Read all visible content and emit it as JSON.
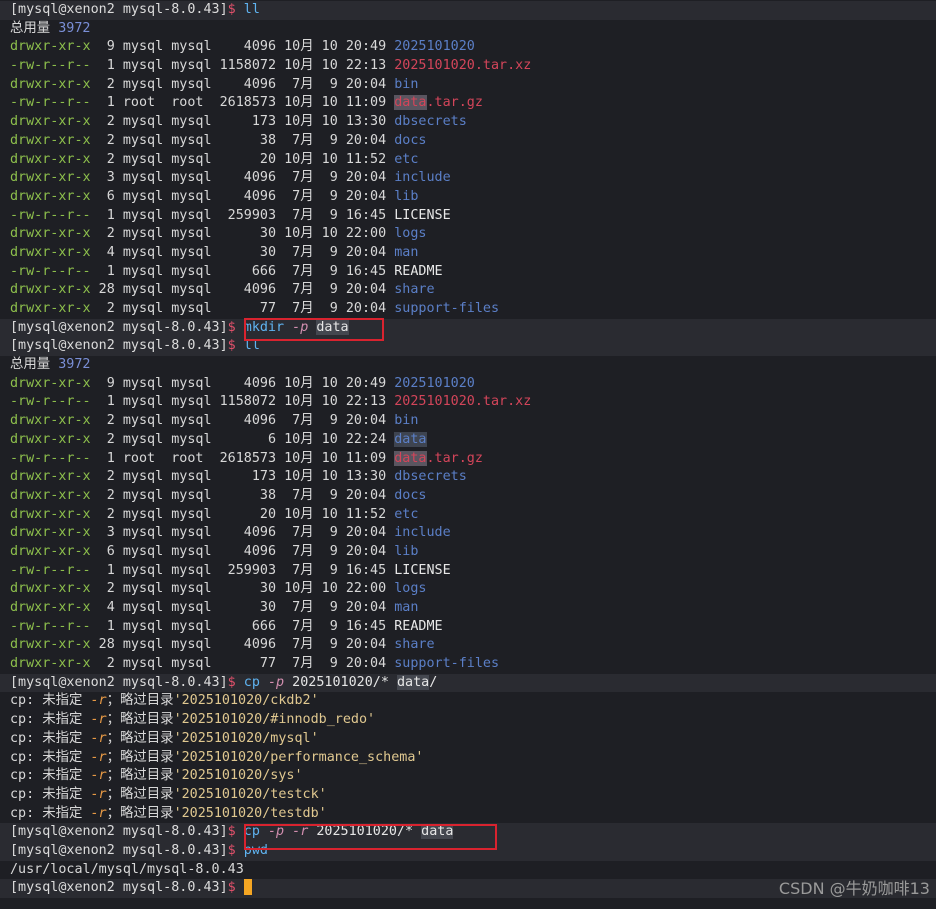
{
  "prompt": {
    "user": "mysql",
    "host": "xenon2",
    "dir": "mysql-8.0.43"
  },
  "listing1": {
    "total_label": "总用量",
    "total_value": "3972",
    "rows": [
      {
        "perm": "drwxr-xr-x",
        "links": " 9",
        "owner": "mysql",
        "group": "mysql",
        "size": "   4096",
        "month": "10月",
        "day": "10",
        "time": "20:49",
        "name": "2025101020",
        "type": "dir"
      },
      {
        "perm": "-rw-r--r--",
        "links": " 1",
        "owner": "mysql",
        "group": "mysql",
        "size": "1158072",
        "month": "10月",
        "day": "10",
        "time": "22:13",
        "name": "2025101020.tar.xz",
        "type": "arch"
      },
      {
        "perm": "drwxr-xr-x",
        "links": " 2",
        "owner": "mysql",
        "group": "mysql",
        "size": "   4096",
        "month": " 7月",
        "day": " 9",
        "time": "20:04",
        "name": "bin",
        "type": "dir"
      },
      {
        "perm": "-rw-r--r--",
        "links": " 1",
        "owner": "root ",
        "group": "root ",
        "size": "2618573",
        "month": "10月",
        "day": "10",
        "time": "11:09",
        "name_hl": "data",
        "name_rest": ".tar.gz",
        "type": "arch-hl"
      },
      {
        "perm": "drwxr-xr-x",
        "links": " 2",
        "owner": "mysql",
        "group": "mysql",
        "size": "    173",
        "month": "10月",
        "day": "10",
        "time": "13:30",
        "name": "dbsecrets",
        "type": "dir"
      },
      {
        "perm": "drwxr-xr-x",
        "links": " 2",
        "owner": "mysql",
        "group": "mysql",
        "size": "     38",
        "month": " 7月",
        "day": " 9",
        "time": "20:04",
        "name": "docs",
        "type": "dir"
      },
      {
        "perm": "drwxr-xr-x",
        "links": " 2",
        "owner": "mysql",
        "group": "mysql",
        "size": "     20",
        "month": "10月",
        "day": "10",
        "time": "11:52",
        "name": "etc",
        "type": "dir"
      },
      {
        "perm": "drwxr-xr-x",
        "links": " 3",
        "owner": "mysql",
        "group": "mysql",
        "size": "   4096",
        "month": " 7月",
        "day": " 9",
        "time": "20:04",
        "name": "include",
        "type": "dir"
      },
      {
        "perm": "drwxr-xr-x",
        "links": " 6",
        "owner": "mysql",
        "group": "mysql",
        "size": "   4096",
        "month": " 7月",
        "day": " 9",
        "time": "20:04",
        "name": "lib",
        "type": "dir"
      },
      {
        "perm": "-rw-r--r--",
        "links": " 1",
        "owner": "mysql",
        "group": "mysql",
        "size": " 259903",
        "month": " 7月",
        "day": " 9",
        "time": "16:45",
        "name": "LICENSE",
        "type": "plain"
      },
      {
        "perm": "drwxr-xr-x",
        "links": " 2",
        "owner": "mysql",
        "group": "mysql",
        "size": "     30",
        "month": "10月",
        "day": "10",
        "time": "22:00",
        "name": "logs",
        "type": "dir"
      },
      {
        "perm": "drwxr-xr-x",
        "links": " 4",
        "owner": "mysql",
        "group": "mysql",
        "size": "     30",
        "month": " 7月",
        "day": " 9",
        "time": "20:04",
        "name": "man",
        "type": "dir"
      },
      {
        "perm": "-rw-r--r--",
        "links": " 1",
        "owner": "mysql",
        "group": "mysql",
        "size": "    666",
        "month": " 7月",
        "day": " 9",
        "time": "16:45",
        "name": "README",
        "type": "plain"
      },
      {
        "perm": "drwxr-xr-x",
        "links": "28",
        "owner": "mysql",
        "group": "mysql",
        "size": "   4096",
        "month": " 7月",
        "day": " 9",
        "time": "20:04",
        "name": "share",
        "type": "dir"
      },
      {
        "perm": "drwxr-xr-x",
        "links": " 2",
        "owner": "mysql",
        "group": "mysql",
        "size": "     77",
        "month": " 7月",
        "day": " 9",
        "time": "20:04",
        "name": "support-files",
        "type": "dir"
      }
    ]
  },
  "listing2": {
    "total_label": "总用量",
    "total_value": "3972",
    "rows": [
      {
        "perm": "drwxr-xr-x",
        "links": " 9",
        "owner": "mysql",
        "group": "mysql",
        "size": "   4096",
        "month": "10月",
        "day": "10",
        "time": "20:49",
        "name": "2025101020",
        "type": "dir"
      },
      {
        "perm": "-rw-r--r--",
        "links": " 1",
        "owner": "mysql",
        "group": "mysql",
        "size": "1158072",
        "month": "10月",
        "day": "10",
        "time": "22:13",
        "name": "2025101020.tar.xz",
        "type": "arch"
      },
      {
        "perm": "drwxr-xr-x",
        "links": " 2",
        "owner": "mysql",
        "group": "mysql",
        "size": "   4096",
        "month": " 7月",
        "day": " 9",
        "time": "20:04",
        "name": "bin",
        "type": "dir"
      },
      {
        "perm": "drwxr-xr-x",
        "links": " 2",
        "owner": "mysql",
        "group": "mysql",
        "size": "      6",
        "month": "10月",
        "day": "10",
        "time": "22:24",
        "name": "data",
        "type": "dir-hl"
      },
      {
        "perm": "-rw-r--r--",
        "links": " 1",
        "owner": "root ",
        "group": "root ",
        "size": "2618573",
        "month": "10月",
        "day": "10",
        "time": "11:09",
        "name_hl": "data",
        "name_rest": ".tar.gz",
        "type": "arch-hl"
      },
      {
        "perm": "drwxr-xr-x",
        "links": " 2",
        "owner": "mysql",
        "group": "mysql",
        "size": "    173",
        "month": "10月",
        "day": "10",
        "time": "13:30",
        "name": "dbsecrets",
        "type": "dir"
      },
      {
        "perm": "drwxr-xr-x",
        "links": " 2",
        "owner": "mysql",
        "group": "mysql",
        "size": "     38",
        "month": " 7月",
        "day": " 9",
        "time": "20:04",
        "name": "docs",
        "type": "dir"
      },
      {
        "perm": "drwxr-xr-x",
        "links": " 2",
        "owner": "mysql",
        "group": "mysql",
        "size": "     20",
        "month": "10月",
        "day": "10",
        "time": "11:52",
        "name": "etc",
        "type": "dir"
      },
      {
        "perm": "drwxr-xr-x",
        "links": " 3",
        "owner": "mysql",
        "group": "mysql",
        "size": "   4096",
        "month": " 7月",
        "day": " 9",
        "time": "20:04",
        "name": "include",
        "type": "dir"
      },
      {
        "perm": "drwxr-xr-x",
        "links": " 6",
        "owner": "mysql",
        "group": "mysql",
        "size": "   4096",
        "month": " 7月",
        "day": " 9",
        "time": "20:04",
        "name": "lib",
        "type": "dir"
      },
      {
        "perm": "-rw-r--r--",
        "links": " 1",
        "owner": "mysql",
        "group": "mysql",
        "size": " 259903",
        "month": " 7月",
        "day": " 9",
        "time": "16:45",
        "name": "LICENSE",
        "type": "plain"
      },
      {
        "perm": "drwxr-xr-x",
        "links": " 2",
        "owner": "mysql",
        "group": "mysql",
        "size": "     30",
        "month": "10月",
        "day": "10",
        "time": "22:00",
        "name": "logs",
        "type": "dir"
      },
      {
        "perm": "drwxr-xr-x",
        "links": " 4",
        "owner": "mysql",
        "group": "mysql",
        "size": "     30",
        "month": " 7月",
        "day": " 9",
        "time": "20:04",
        "name": "man",
        "type": "dir"
      },
      {
        "perm": "-rw-r--r--",
        "links": " 1",
        "owner": "mysql",
        "group": "mysql",
        "size": "    666",
        "month": " 7月",
        "day": " 9",
        "time": "16:45",
        "name": "README",
        "type": "plain"
      },
      {
        "perm": "drwxr-xr-x",
        "links": "28",
        "owner": "mysql",
        "group": "mysql",
        "size": "   4096",
        "month": " 7月",
        "day": " 9",
        "time": "20:04",
        "name": "share",
        "type": "dir"
      },
      {
        "perm": "drwxr-xr-x",
        "links": " 2",
        "owner": "mysql",
        "group": "mysql",
        "size": "     77",
        "month": " 7月",
        "day": " 9",
        "time": "20:04",
        "name": "support-files",
        "type": "dir"
      }
    ]
  },
  "commands": {
    "ll": "ll",
    "mkdir": {
      "cmd": "mkdir",
      "opt": "-p",
      "arg": "data"
    },
    "cp1": {
      "cmd": "cp",
      "opt": "-p",
      "src": "2025101020/*",
      "dst": "data",
      "slash": "/"
    },
    "cp2": {
      "cmd": "cp",
      "opt1": "-p",
      "opt2": "-r",
      "src": "2025101020/*",
      "dst": "data"
    },
    "pwd": "pwd"
  },
  "cp_errors": {
    "prefix": "cp: 未指定 ",
    "flag": "-r",
    "mid": "；略过目录",
    "dirs": [
      "'2025101020/ckdb2'",
      "'2025101020/#innodb_redo'",
      "'2025101020/mysql'",
      "'2025101020/performance_schema'",
      "'2025101020/sys'",
      "'2025101020/testck'",
      "'2025101020/testdb'"
    ]
  },
  "pwd_output": "/usr/local/mysql/mysql-8.0.43",
  "watermark": "CSDN @牛奶咖啡13",
  "colors": {
    "dir": "#5b7fc7",
    "archive": "#d3455a",
    "perm": "#8dbf4c",
    "highlight_box": "#d9232f",
    "cursor": "#f5a623"
  }
}
